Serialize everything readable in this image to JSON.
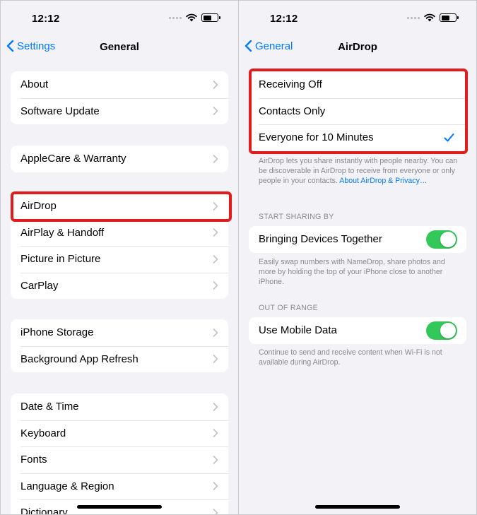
{
  "status": {
    "time": "12:12"
  },
  "left": {
    "back_label": "Settings",
    "title": "General",
    "group1": [
      "About",
      "Software Update"
    ],
    "group2": [
      "AppleCare & Warranty"
    ],
    "group3": [
      "AirDrop",
      "AirPlay & Handoff",
      "Picture in Picture",
      "CarPlay"
    ],
    "group4": [
      "iPhone Storage",
      "Background App Refresh"
    ],
    "group5": [
      "Date & Time",
      "Keyboard",
      "Fonts",
      "Language & Region",
      "Dictionary"
    ]
  },
  "right": {
    "back_label": "General",
    "title": "AirDrop",
    "options": [
      "Receiving Off",
      "Contacts Only",
      "Everyone for 10 Minutes"
    ],
    "selected_option": "Everyone for 10 Minutes",
    "airdrop_footer": "AirDrop lets you share instantly with people nearby. You can be discoverable in AirDrop to receive from everyone or only people in your contacts.",
    "airdrop_footer_link": "About AirDrop & Privacy…",
    "start_sharing_header": "START SHARING BY",
    "bringing_devices_label": "Bringing Devices Together",
    "bringing_devices_on": true,
    "bringing_devices_footer": "Easily swap numbers with NameDrop, share photos and more by holding the top of your iPhone close to another iPhone.",
    "out_of_range_header": "OUT OF RANGE",
    "mobile_data_label": "Use Mobile Data",
    "mobile_data_on": true,
    "mobile_data_footer": "Continue to send and receive content when Wi-Fi is not available during AirDrop."
  },
  "colors": {
    "accent": "#007aff",
    "toggle_on": "#34c759",
    "highlight": "#e11c1c",
    "background": "#f2f2f7"
  }
}
